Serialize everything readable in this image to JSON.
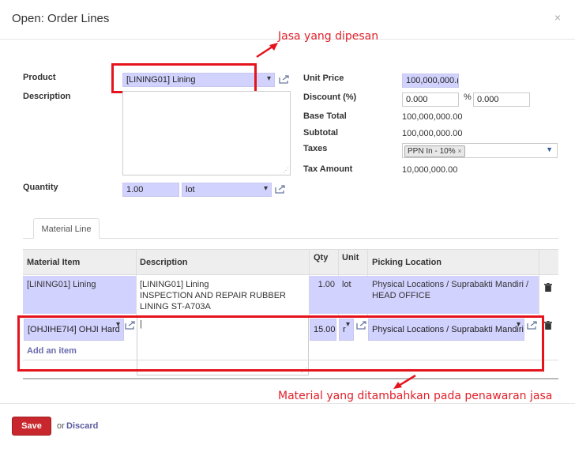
{
  "dialog": {
    "title": "Open: Order Lines",
    "close_symbol": "×"
  },
  "annotations": {
    "top": "Jasa yang dipesan",
    "bottom": "Material yang ditambahkan pada penawaran jasa",
    "color": "#e5131c"
  },
  "form": {
    "product_label": "Product",
    "product_value": "[LINING01] Lining",
    "description_label": "Description",
    "description_value": "",
    "quantity_label": "Quantity",
    "quantity_value": "1.00",
    "uom_value": "lot",
    "unit_price_label": "Unit Price",
    "unit_price_value": "100,000,000.(",
    "discount_label": "Discount (%)",
    "discount_value": "0.000",
    "discount_sep": "%",
    "discount_value2": "0.000",
    "base_total_label": "Base Total",
    "base_total_value": "100,000,000.00",
    "subtotal_label": "Subtotal",
    "subtotal_value": "100,000,000.00",
    "taxes_label": "Taxes",
    "tax_tag": "PPN In - 10%",
    "tax_amount_label": "Tax Amount",
    "tax_amount_value": "10,000,000.00"
  },
  "tabs": [
    {
      "label": "Material Line"
    }
  ],
  "table": {
    "headers": [
      "Material Item",
      "Description",
      "Qty",
      "Unit",
      "Picking Location"
    ],
    "rows": [
      {
        "item": "[LINING01] Lining",
        "description_lines": [
          "[LINING01] Lining",
          "INSPECTION AND REPAIR RUBBER",
          "LINING ST-A703A"
        ],
        "qty": "1.00",
        "unit": "lot",
        "location_lines": [
          "Physical Locations / Suprabakti Mandiri /",
          "HEAD OFFICE"
        ]
      }
    ],
    "edit_row": {
      "item": "[OHJIHE7I4] OHJI Hard",
      "description": "|",
      "qty": "15.00",
      "unit": "r",
      "location": "Physical Locations / Suprabakti Mandiri"
    },
    "add_item": "Add an item"
  },
  "footer": {
    "save_label": "Save",
    "or_text": "or",
    "discard_label": "Discard"
  },
  "colors": {
    "field_bg": "#d2d2ff",
    "save_bg": "#c8282d",
    "accent_link": "#6b6bb0"
  }
}
